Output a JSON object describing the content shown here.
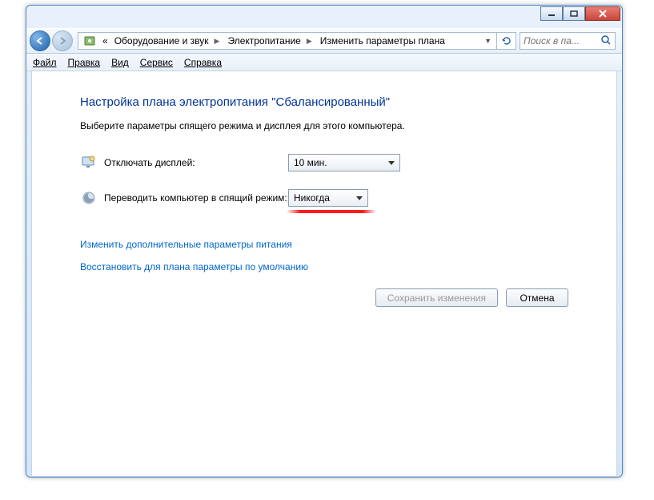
{
  "breadcrumb": {
    "item1": "Оборудование и звук",
    "item2": "Электропитание",
    "item3": "Изменить параметры плана"
  },
  "search": {
    "placeholder": "Поиск в па..."
  },
  "menu": {
    "file": "Файл",
    "edit": "Правка",
    "view": "Вид",
    "tools": "Сервис",
    "help": "Справка"
  },
  "page": {
    "heading": "Настройка плана электропитания \"Сбалансированный\"",
    "subtext": "Выберите параметры спящего режима и дисплея для этого компьютера.",
    "row1_label": "Отключать дисплей:",
    "row1_value": "10 мин.",
    "row2_label": "Переводить компьютер в спящий режим:",
    "row2_value": "Никогда",
    "link1": "Изменить дополнительные параметры питания",
    "link2": "Восстановить для плана параметры по умолчанию",
    "save_btn": "Сохранить изменения",
    "cancel_btn": "Отмена"
  }
}
